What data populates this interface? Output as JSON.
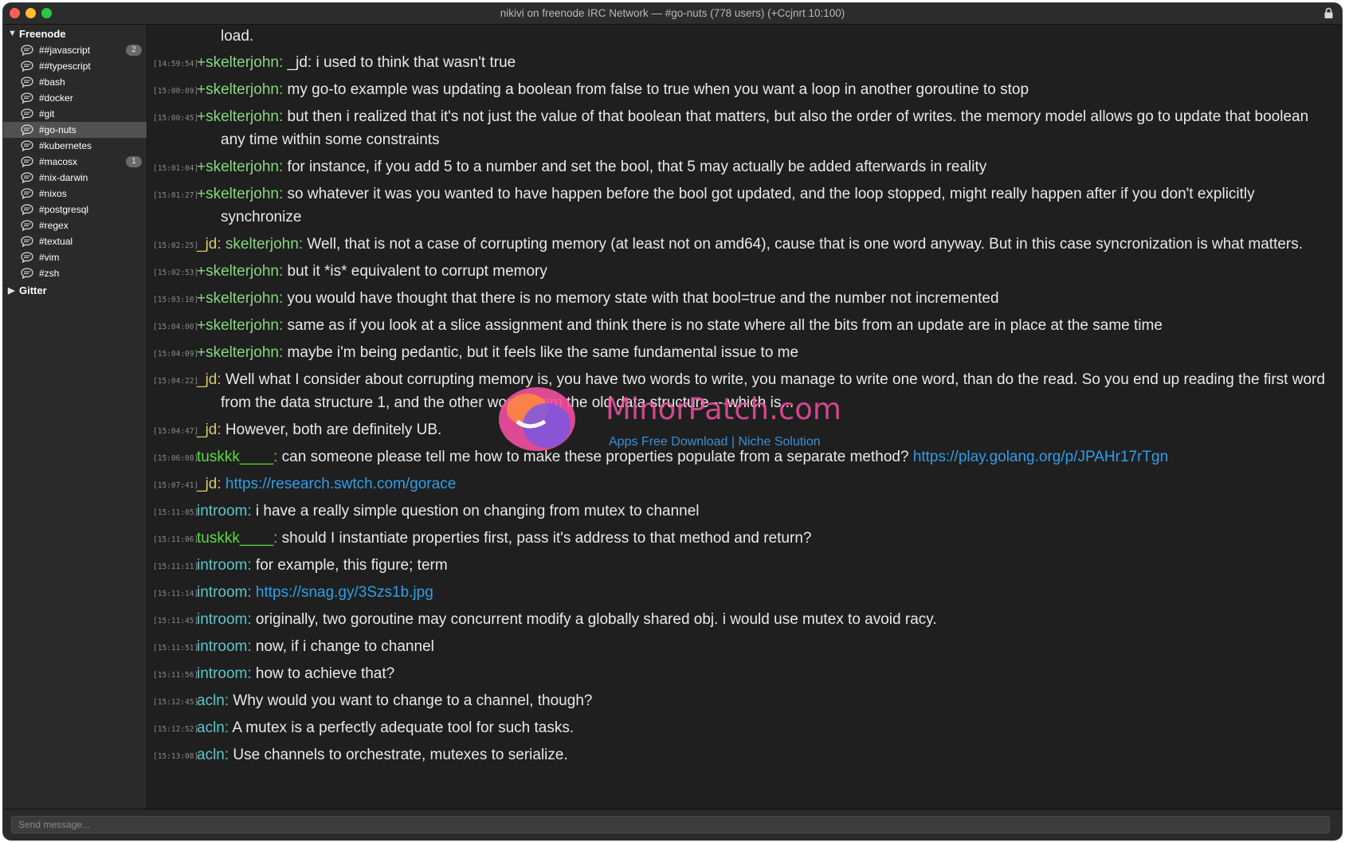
{
  "window": {
    "title": "nikivi on freenode IRC Network — #go-nuts (778 users) (+Ccjnrt 10:100)"
  },
  "sidebar": {
    "groups": [
      {
        "label": "Freenode",
        "expanded": true,
        "channels": [
          {
            "name": "##javascript",
            "badge": "2"
          },
          {
            "name": "##typescript",
            "badge": ""
          },
          {
            "name": "#bash",
            "badge": ""
          },
          {
            "name": "#docker",
            "badge": ""
          },
          {
            "name": "#git",
            "badge": ""
          },
          {
            "name": "#go-nuts",
            "badge": "",
            "selected": true
          },
          {
            "name": "#kubernetes",
            "badge": ""
          },
          {
            "name": "#macosx",
            "badge": "1"
          },
          {
            "name": "#nix-darwin",
            "badge": ""
          },
          {
            "name": "#nixos",
            "badge": ""
          },
          {
            "name": "#postgresql",
            "badge": ""
          },
          {
            "name": "#regex",
            "badge": ""
          },
          {
            "name": "#textual",
            "badge": ""
          },
          {
            "name": "#vim",
            "badge": ""
          },
          {
            "name": "#zsh",
            "badge": ""
          }
        ]
      },
      {
        "label": "Gitter",
        "expanded": false,
        "channels": []
      }
    ]
  },
  "messages": {
    "continued_text": "load.",
    "items": [
      {
        "ts": "[14:59:54]",
        "nick": "+skelterjohn:",
        "color": "#86d67f",
        "mention": "",
        "text": " _jd: i used to think that wasn't true",
        "link": ""
      },
      {
        "ts": "[15:00:09]",
        "nick": "+skelterjohn:",
        "color": "#86d67f",
        "mention": "",
        "text": " my go-to example was updating a boolean from false to true when you want a loop in another goroutine to stop",
        "link": ""
      },
      {
        "ts": "[15:00:45]",
        "nick": "+skelterjohn:",
        "color": "#86d67f",
        "mention": "",
        "text": " but then i realized that it's not just the value of that boolean that matters, but also the order of writes. the memory model allows go to update that boolean any time within some constraints",
        "link": ""
      },
      {
        "ts": "[15:01:04]",
        "nick": "+skelterjohn:",
        "color": "#86d67f",
        "mention": "",
        "text": " for instance, if you add 5 to a number and set the bool, that 5 may actually be added afterwards in reality",
        "link": ""
      },
      {
        "ts": "[15:01:27]",
        "nick": "+skelterjohn:",
        "color": "#86d67f",
        "mention": "",
        "text": " so whatever it was you wanted to have happen before the bool got updated, and the loop stopped, might really happen after if you don't explicitly synchronize",
        "link": ""
      },
      {
        "ts": "[15:02:25]",
        "nick": "_jd:",
        "color": "#d9c86a",
        "mention": " skelterjohn:",
        "text": " Well, that is not a case of corrupting memory (at least not on amd64), cause that is one word anyway. But in this case syncronization is what matters.",
        "link": ""
      },
      {
        "ts": "[15:02:53]",
        "nick": "+skelterjohn:",
        "color": "#86d67f",
        "mention": "",
        "text": " but it *is* equivalent to corrupt memory",
        "link": ""
      },
      {
        "ts": "[15:03:10]",
        "nick": "+skelterjohn:",
        "color": "#86d67f",
        "mention": "",
        "text": " you would have thought that there is no memory state with that bool=true and the number not incremented",
        "link": ""
      },
      {
        "ts": "[15:04:00]",
        "nick": "+skelterjohn:",
        "color": "#86d67f",
        "mention": "",
        "text": " same as if you look at a slice assignment and think there is no state where all the bits from an update are in place at the same time",
        "link": ""
      },
      {
        "ts": "[15:04:09]",
        "nick": "+skelterjohn:",
        "color": "#86d67f",
        "mention": "",
        "text": " maybe i'm being pedantic, but it feels like the same fundamental issue to me",
        "link": ""
      },
      {
        "ts": "[15:04:22]",
        "nick": "_jd:",
        "color": "#d9c86a",
        "mention": "",
        "text": " Well what I consider about corrupting memory is, you have two words to write, you manage to write one word, than do the read. So you end up reading the first word from the data structure 1, and the other words from the old data structure -- which is...",
        "link": ""
      },
      {
        "ts": "[15:04:47]",
        "nick": "_jd:",
        "color": "#d9c86a",
        "mention": "",
        "text": " However, both are definitely UB.",
        "link": ""
      },
      {
        "ts": "[15:06:08]",
        "nick": "tuskkk____:",
        "color": "#5cdb3e",
        "mention": "",
        "text": " can someone please tell me how to make these properties populate from a separate method? ",
        "link": "https://play.golang.org/p/JPAHr17rTgn"
      },
      {
        "ts": "[15:07:41]",
        "nick": "_jd:",
        "color": "#d9c86a",
        "mention": "",
        "text": " ",
        "link": "https://research.swtch.com/gorace"
      },
      {
        "ts": "[15:11:05]",
        "nick": "introom:",
        "color": "#5ec5c8",
        "mention": "",
        "text": " i have a really simple question on changing from mutex to channel",
        "link": ""
      },
      {
        "ts": "[15:11:06]",
        "nick": "tuskkk____:",
        "color": "#5cdb3e",
        "mention": "",
        "text": " should I instantiate properties first, pass it's address to that method and return?",
        "link": ""
      },
      {
        "ts": "[15:11:11]",
        "nick": "introom:",
        "color": "#5ec5c8",
        "mention": "",
        "text": " for example, this figure; term",
        "link": ""
      },
      {
        "ts": "[15:11:14]",
        "nick": "introom:",
        "color": "#5ec5c8",
        "mention": "",
        "text": " ",
        "link": "https://snag.gy/3Szs1b.jpg"
      },
      {
        "ts": "[15:11:45]",
        "nick": "introom:",
        "color": "#5ec5c8",
        "mention": "",
        "text": " originally, two goroutine may concurrent modify a globally shared obj.  i would use mutex to avoid racy.",
        "link": ""
      },
      {
        "ts": "[15:11:51]",
        "nick": "introom:",
        "color": "#5ec5c8",
        "mention": "",
        "text": " now, if i change to channel",
        "link": ""
      },
      {
        "ts": "[15:11:56]",
        "nick": "introom:",
        "color": "#5ec5c8",
        "mention": "",
        "text": " how to achieve that?",
        "link": ""
      },
      {
        "ts": "[15:12:45]",
        "nick": "acln:",
        "color": "#5ec5c8",
        "mention": "",
        "text": " Why would you want to change to a channel, though?",
        "link": ""
      },
      {
        "ts": "[15:12:52]",
        "nick": "acln:",
        "color": "#5ec5c8",
        "mention": "",
        "text": " A mutex is a perfectly adequate tool for such tasks.",
        "link": ""
      },
      {
        "ts": "[15:13:08]",
        "nick": "acln:",
        "color": "#5ec5c8",
        "mention": "",
        "text": " Use channels to orchestrate, mutexes to serialize.",
        "link": ""
      }
    ]
  },
  "input": {
    "placeholder": "Send message..."
  },
  "watermark": {
    "title": "MinorPatch.com",
    "subtitle": "Apps Free Download | Niche Solution"
  }
}
